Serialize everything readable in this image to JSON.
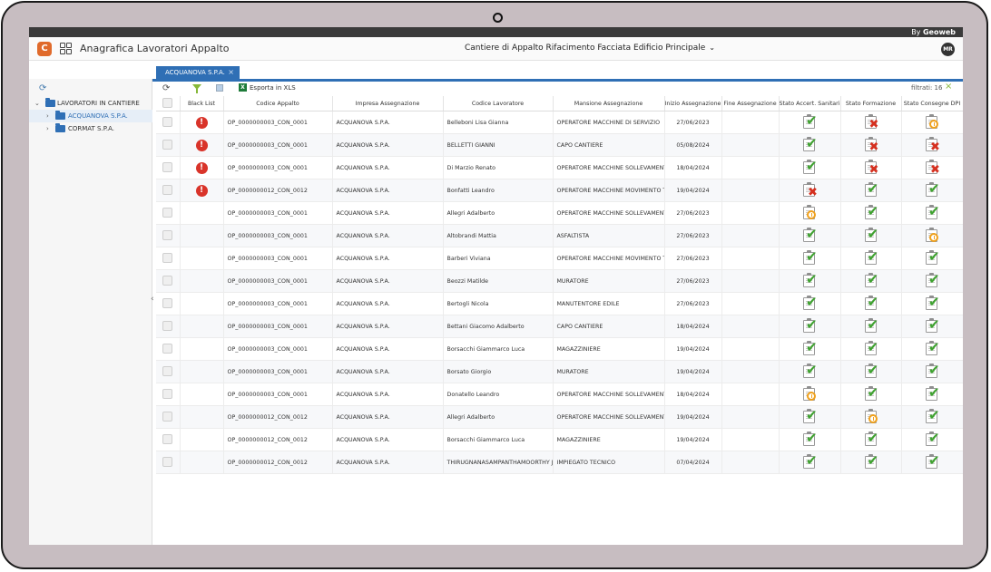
{
  "brand": {
    "prefix": "By",
    "name": "Geoweb"
  },
  "app": {
    "logo_letter": "C",
    "title": "Anagrafica Lavoratori Appalto",
    "site": "Cantiere di Appalto Rifacimento Facciata Edificio Principale",
    "user_initials": "MR"
  },
  "tree": {
    "root": "LAVORATORI IN CANTIERE",
    "children": [
      "ACQUANOVA S.P.A.",
      "CORMAT S.P.A."
    ],
    "selected": "ACQUANOVA S.P.A."
  },
  "tab": {
    "label": "ACQUANOVA S.P.A.",
    "close": "×"
  },
  "toolbar": {
    "export_label": "Esporta in XLS",
    "count_label": "filtrati: 16",
    "clear_icon": "×"
  },
  "columns": [
    "Black List",
    "Codice Appalto",
    "Impresa Assegnazione",
    "Codice Lavoratore",
    "Mansione Assegnazione",
    "Inizio Assegnazione",
    "Fine Assegnazione",
    "Stato Accert. Sanitari",
    "Stato Formazione",
    "Stato Consegne DPI"
  ],
  "status_icons": {
    "ok": "✔",
    "ko": "✖",
    "wait": "clock"
  },
  "colors": {
    "accent": "#2f6fb5",
    "ok": "#3ea22f",
    "ko": "#d6301f",
    "wait": "#f0a11c",
    "blacklist": "#d9342a"
  },
  "rows": [
    {
      "black": true,
      "codice": "OP_0000000003_CON_0001",
      "impresa": "ACQUANOVA S.P.A.",
      "lavoratore": "Belleboni Lisa Gianna",
      "mansione": "OPERATORE MACCHINE DI SERVIZIO",
      "inizio": "27/06/2023",
      "fine": "",
      "san": "ok",
      "form": "ko",
      "dpi": "wait"
    },
    {
      "black": true,
      "codice": "OP_0000000003_CON_0001",
      "impresa": "ACQUANOVA S.P.A.",
      "lavoratore": "BELLETTI GIANNI",
      "mansione": "CAPO CANTIERE",
      "inizio": "05/08/2024",
      "fine": "",
      "san": "ok",
      "form": "ko",
      "dpi": "ko"
    },
    {
      "black": true,
      "codice": "OP_0000000003_CON_0001",
      "impresa": "ACQUANOVA S.P.A.",
      "lavoratore": "Di Marzio Renato",
      "mansione": "OPERATORE MACCHINE SOLLEVAMENTO",
      "inizio": "18/04/2024",
      "fine": "",
      "san": "ok",
      "form": "ko",
      "dpi": "ko"
    },
    {
      "black": true,
      "codice": "OP_0000000012_CON_0012",
      "impresa": "ACQUANOVA S.P.A.",
      "lavoratore": "Bonfatti Leandro",
      "mansione": "OPERATORE MACCHINE MOVIMENTO TERRA",
      "inizio": "19/04/2024",
      "fine": "",
      "san": "ko",
      "form": "ok",
      "dpi": "ok"
    },
    {
      "black": false,
      "codice": "OP_0000000003_CON_0001",
      "impresa": "ACQUANOVA S.P.A.",
      "lavoratore": "Allegri Adalberto",
      "mansione": "OPERATORE MACCHINE SOLLEVAMENTO",
      "inizio": "27/06/2023",
      "fine": "",
      "san": "wait",
      "form": "ok",
      "dpi": "ok"
    },
    {
      "black": false,
      "codice": "OP_0000000003_CON_0001",
      "impresa": "ACQUANOVA S.P.A.",
      "lavoratore": "Altobrandi Mattia",
      "mansione": "ASFALTISTA",
      "inizio": "27/06/2023",
      "fine": "",
      "san": "ok",
      "form": "ok",
      "dpi": "wait"
    },
    {
      "black": false,
      "codice": "OP_0000000003_CON_0001",
      "impresa": "ACQUANOVA S.P.A.",
      "lavoratore": "Barberi Viviana",
      "mansione": "OPERATORE MACCHINE MOVIMENTO TERRA",
      "inizio": "27/06/2023",
      "fine": "",
      "san": "ok",
      "form": "ok",
      "dpi": "ok"
    },
    {
      "black": false,
      "codice": "OP_0000000003_CON_0001",
      "impresa": "ACQUANOVA S.P.A.",
      "lavoratore": "Beozzi Matilde",
      "mansione": "MURATORE",
      "inizio": "27/06/2023",
      "fine": "",
      "san": "ok",
      "form": "ok",
      "dpi": "ok"
    },
    {
      "black": false,
      "codice": "OP_0000000003_CON_0001",
      "impresa": "ACQUANOVA S.P.A.",
      "lavoratore": "Bertogli Nicola",
      "mansione": "MANUTENTORE EDILE",
      "inizio": "27/06/2023",
      "fine": "",
      "san": "ok",
      "form": "ok",
      "dpi": "ok"
    },
    {
      "black": false,
      "codice": "OP_0000000003_CON_0001",
      "impresa": "ACQUANOVA S.P.A.",
      "lavoratore": "Bettani Giacomo Adalberto",
      "mansione": "CAPO CANTIERE",
      "inizio": "18/04/2024",
      "fine": "",
      "san": "ok",
      "form": "ok",
      "dpi": "ok"
    },
    {
      "black": false,
      "codice": "OP_0000000003_CON_0001",
      "impresa": "ACQUANOVA S.P.A.",
      "lavoratore": "Borsacchi Giammarco Luca",
      "mansione": "MAGAZZINIERE",
      "inizio": "19/04/2024",
      "fine": "",
      "san": "ok",
      "form": "ok",
      "dpi": "ok"
    },
    {
      "black": false,
      "codice": "OP_0000000003_CON_0001",
      "impresa": "ACQUANOVA S.P.A.",
      "lavoratore": "Borsato Giorgio",
      "mansione": "MURATORE",
      "inizio": "19/04/2024",
      "fine": "",
      "san": "ok",
      "form": "ok",
      "dpi": "ok"
    },
    {
      "black": false,
      "codice": "OP_0000000003_CON_0001",
      "impresa": "ACQUANOVA S.P.A.",
      "lavoratore": "Donatello Leandro",
      "mansione": "OPERATORE MACCHINE SOLLEVAMENTO",
      "inizio": "18/04/2024",
      "fine": "",
      "san": "wait",
      "form": "ok",
      "dpi": "ok"
    },
    {
      "black": false,
      "codice": "OP_0000000012_CON_0012",
      "impresa": "ACQUANOVA S.P.A.",
      "lavoratore": "Allegri Adalberto",
      "mansione": "OPERATORE MACCHINE SOLLEVAMENTO",
      "inizio": "19/04/2024",
      "fine": "",
      "san": "ok",
      "form": "wait",
      "dpi": "ok"
    },
    {
      "black": false,
      "codice": "OP_0000000012_CON_0012",
      "impresa": "ACQUANOVA S.P.A.",
      "lavoratore": "Borsacchi Giammarco Luca",
      "mansione": "MAGAZZINIERE",
      "inizio": "19/04/2024",
      "fine": "",
      "san": "ok",
      "form": "ok",
      "dpi": "ok"
    },
    {
      "black": false,
      "codice": "OP_0000000012_CON_0012",
      "impresa": "ACQUANOVA S.P.A.",
      "lavoratore": "THIRUGNANASAMPANTHAMOORTHY JANICE LOKELANI",
      "mansione": "IMPIEGATO TECNICO",
      "inizio": "07/04/2024",
      "fine": "",
      "san": "ok",
      "form": "ok",
      "dpi": "ok"
    }
  ]
}
